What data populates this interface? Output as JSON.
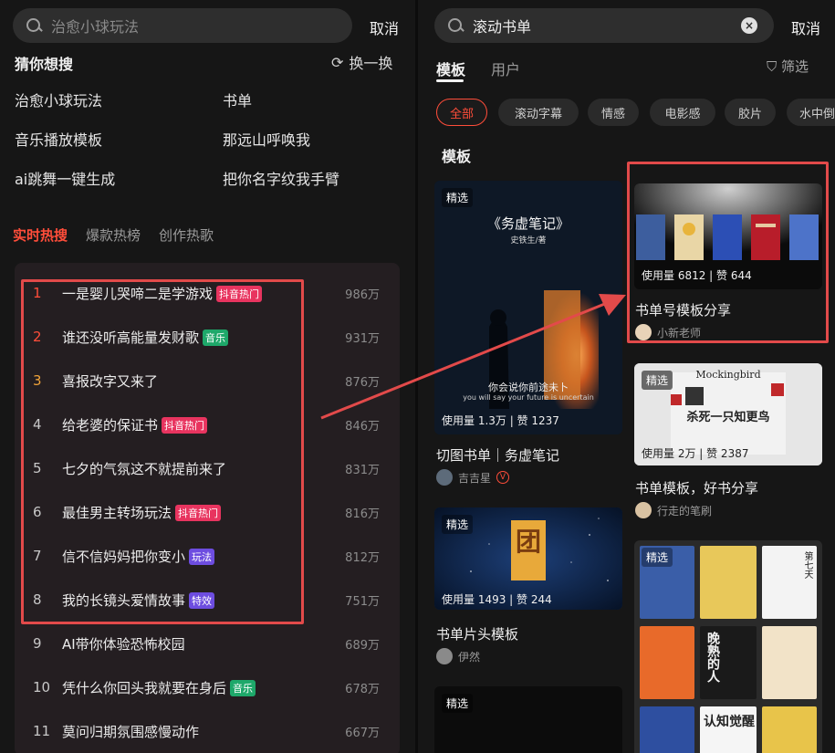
{
  "left": {
    "search": {
      "placeholder": "治愈小球玩法",
      "icon": "search-icon"
    },
    "cancel_label": "取消",
    "guess_title": "猜你想搜",
    "refresh_label": "换一换",
    "suggestions": [
      "治愈小球玩法",
      "书单",
      "音乐播放模板",
      "那远山呼唤我",
      "ai跳舞一键生成",
      "把你名字纹我手臂"
    ],
    "hot_tabs": [
      "实时热搜",
      "爆款热榜",
      "创作热歌"
    ],
    "hot_list": [
      {
        "rank": "1",
        "title": "一是婴儿哭啼二是学游戏",
        "badge": "抖音热门",
        "heat": "986万"
      },
      {
        "rank": "2",
        "title": "谁还没听高能量发财歌",
        "badge": "音乐",
        "heat": "931万"
      },
      {
        "rank": "3",
        "title": "喜报改字又来了",
        "badge": "",
        "heat": "876万"
      },
      {
        "rank": "4",
        "title": "给老婆的保证书",
        "badge": "抖音热门",
        "heat": "846万"
      },
      {
        "rank": "5",
        "title": "七夕的气氛这不就提前来了",
        "badge": "",
        "heat": "831万"
      },
      {
        "rank": "6",
        "title": "最佳男主转场玩法",
        "badge": "抖音热门",
        "heat": "816万"
      },
      {
        "rank": "7",
        "title": "信不信妈妈把你变小",
        "badge": "玩法",
        "heat": "812万"
      },
      {
        "rank": "8",
        "title": "我的长镜头爱情故事",
        "badge": "特效",
        "heat": "751万"
      },
      {
        "rank": "9",
        "title": "AI带你体验恐怖校园",
        "badge": "",
        "heat": "689万"
      },
      {
        "rank": "10",
        "title": "凭什么你回头我就要在身后",
        "badge": "音乐",
        "heat": "678万"
      },
      {
        "rank": "11",
        "title": "莫问归期氛围感慢动作",
        "badge": "",
        "heat": "667万"
      }
    ],
    "colors": {
      "accent": "#ff4d3a",
      "rank_top": "#ff4d3a",
      "rank_third": "#f0a33a",
      "badge_hot": "#e8345f",
      "badge_music": "#1ea86a",
      "badge_play": "#6d4de0"
    }
  },
  "right": {
    "search": {
      "value": "滚动书单",
      "icon": "search-icon"
    },
    "cancel_label": "取消",
    "tabs": [
      "模板",
      "用户"
    ],
    "filter_label": "筛选",
    "chips": [
      "全部",
      "滚动字幕",
      "情感",
      "电影感",
      "胶片",
      "水中倒"
    ],
    "section_label": "模板",
    "card1": {
      "tag": "精选",
      "poster_title": "《务虚笔记》",
      "poster_author": "史铁生/著",
      "poster_quote": "你会说你前途未卜",
      "poster_quote_en": "you will say your future is uncertain",
      "stats": "使用量 1.3万 | 赞 1237",
      "title": "切图书单｜务虚笔记",
      "author": "吉吉星"
    },
    "card2": {
      "stats": "使用量 6812 | 赞 644",
      "title": "书单号模板分享",
      "author": "小新老师"
    },
    "card3": {
      "tag": "精选",
      "poster_en": "Mockingbird",
      "poster_cn": "杀死一只知更鸟",
      "stats": "使用量 2万 | 赞 2387",
      "title": "书单模板，好书分享",
      "author": "行走的笔刷"
    },
    "card4": {
      "tag": "精选",
      "poster_char": "团",
      "stats": "使用量 1493 | 赞 244",
      "title": "书单片头模板",
      "author": "伊然"
    },
    "card5": {
      "tag": "精选"
    },
    "card6": {
      "tag": "精选",
      "book_top_right": "第七天",
      "book_mid": "晚熟的人",
      "book_bottom": "认知觉醒"
    }
  }
}
